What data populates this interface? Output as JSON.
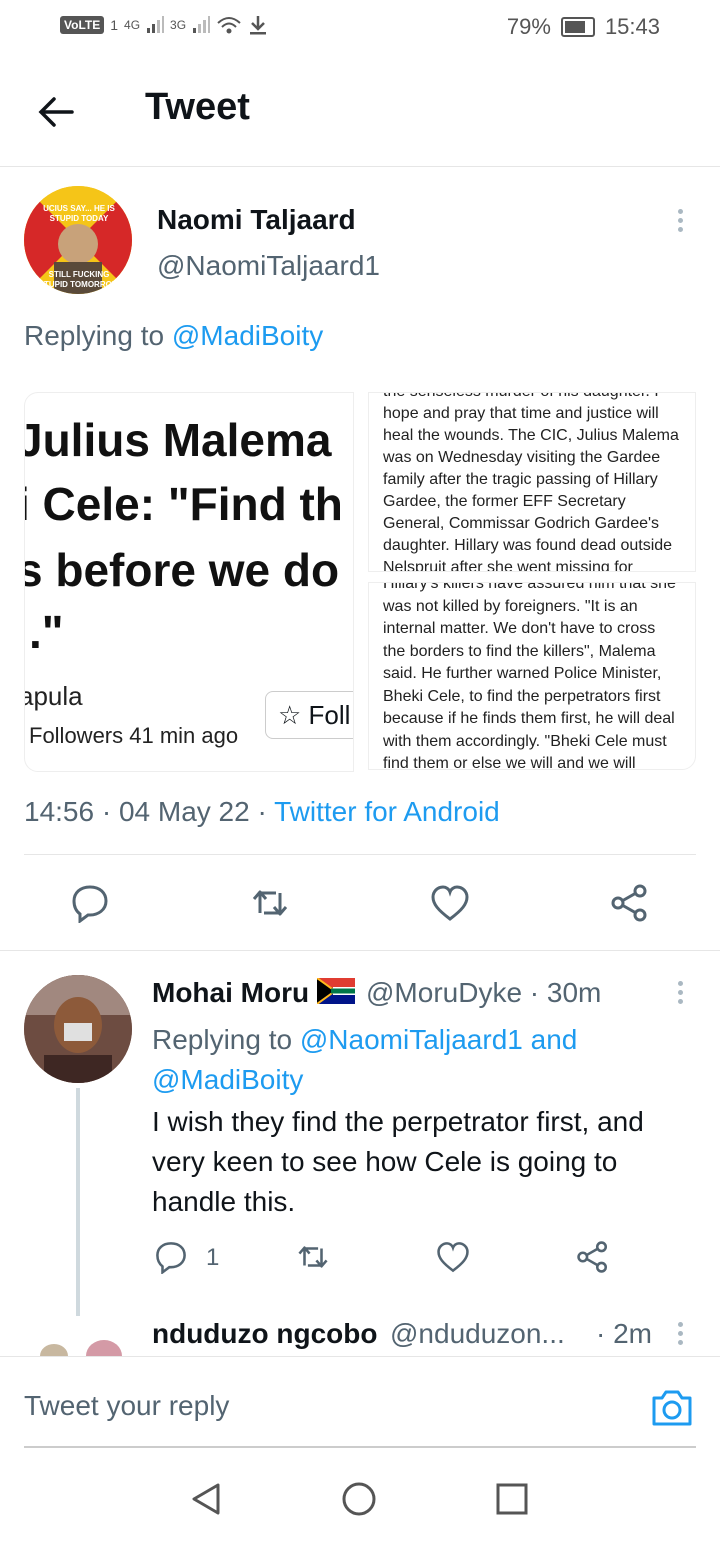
{
  "status_bar": {
    "carrier": "VoLTE",
    "sim": "1",
    "net1": "4G",
    "net2": "3G",
    "battery": "79%",
    "battery_level": 0.79,
    "time": "15:43"
  },
  "header": {
    "title": "Tweet"
  },
  "tweet": {
    "author_name": "Naomi Taljaard",
    "author_handle": "@NaomiTaljaard1",
    "avatar_text_top": "UCIUS SAY... HE IS STUPID TODAY",
    "avatar_text_bottom": "STILL FUCKING STUPID TOMORROW",
    "replying_prefix": "Replying to",
    "replying_to": "@MadiBoity",
    "image_left": {
      "line1": "Julius Malema",
      "line2": "i Cele: \"Find th",
      "line3": "s before we do",
      "line4": ".\"",
      "source": "apula",
      "footer": "Followers 41 min ago",
      "follow": "☆ Foll"
    },
    "image_right_top": "the senseless murder of his daughter. I hope and pray that time and justice will heal the wounds. The CIC, Julius Malema was on Wednesday visiting the Gardee family after the tragic passing of Hillary Gardee, the former EFF Secretary General, Commissar Godrich Gardee's daughter. Hillary was found dead outside Nelspruit after she went missing for",
    "image_right_bottom": "Hillary's killers have assured him that she was not killed by foreigners. \"It is an internal matter. We don't have to cross the borders to find the killers\", Malema said. He further warned Police Minister, Bheki Cele, to find the perpetrators first because if he finds them first, he will deal with them accordingly. \"Bheki Cele must find them or else we will and we will",
    "meta_time": "14:56 · 04 May 22 · ",
    "meta_source": "Twitter for Android"
  },
  "reply": {
    "name": "Mohai Moru",
    "flag": "🇿🇦",
    "handle_time": "@MoruDyke · 30m",
    "replying_prefix": "Replying to ",
    "replying_to": "@NaomiTaljaard1 and @MadiBoity",
    "text": "I wish they find the perpetrator first, and very keen to see how Cele is going to handle this.",
    "reply_count": "1"
  },
  "next_reply": {
    "name": "nduduzo ngcobo",
    "handle": "@nduduzon...",
    "time": "· 2m"
  },
  "compose": {
    "placeholder": "Tweet your reply"
  },
  "colors": {
    "accent": "#1d9bf0",
    "muted": "#536471"
  }
}
